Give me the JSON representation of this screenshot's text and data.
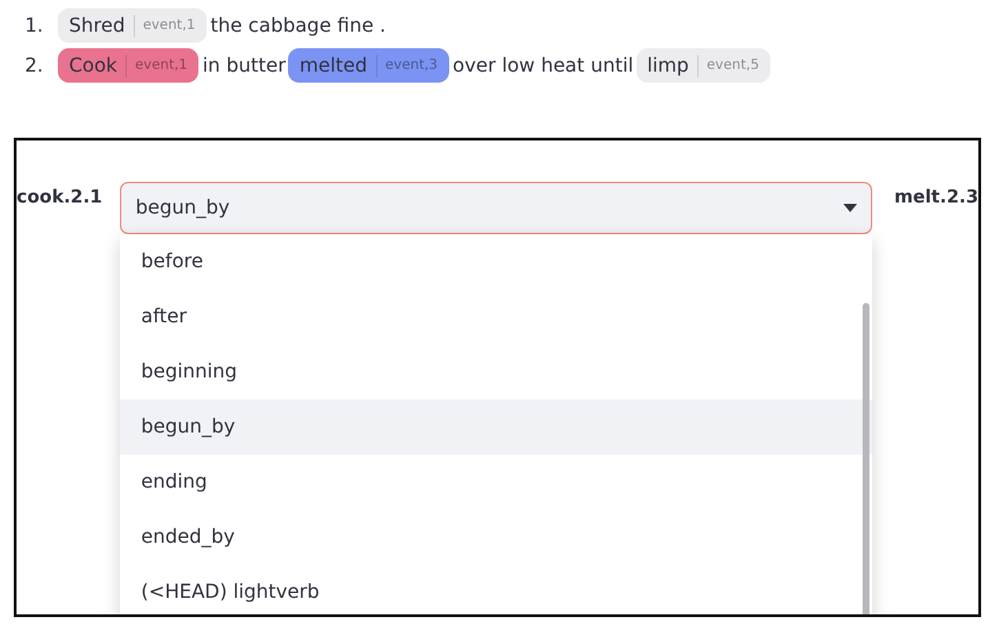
{
  "sentences": [
    {
      "number": "1.",
      "parts": [
        {
          "kind": "token",
          "text": "Shred",
          "tag": "event,1",
          "color": "#ececee"
        },
        {
          "kind": "text",
          "text": "the cabbage fine ."
        }
      ]
    },
    {
      "number": "2.",
      "parts": [
        {
          "kind": "token",
          "text": "Cook",
          "tag": "event,1",
          "color": "#e9728f"
        },
        {
          "kind": "text",
          "text": "in butter"
        },
        {
          "kind": "token",
          "text": "melted",
          "tag": "event,3",
          "color": "#7b93f2"
        },
        {
          "kind": "text",
          "text": "over low heat until"
        },
        {
          "kind": "token",
          "text": "limp",
          "tag": "event,5",
          "color": "#ececee"
        }
      ]
    }
  ],
  "relation": {
    "source": "cook.2.1",
    "target": "melt.2.3",
    "select": {
      "value": "begun_by",
      "expanded": true
    },
    "options": [
      {
        "label": "before",
        "selected": false
      },
      {
        "label": "after",
        "selected": false
      },
      {
        "label": "beginning",
        "selected": false
      },
      {
        "label": "begun_by",
        "selected": true
      },
      {
        "label": "ending",
        "selected": false
      },
      {
        "label": "ended_by",
        "selected": false
      },
      {
        "label": "(<HEAD) lightverb",
        "selected": false
      }
    ]
  }
}
